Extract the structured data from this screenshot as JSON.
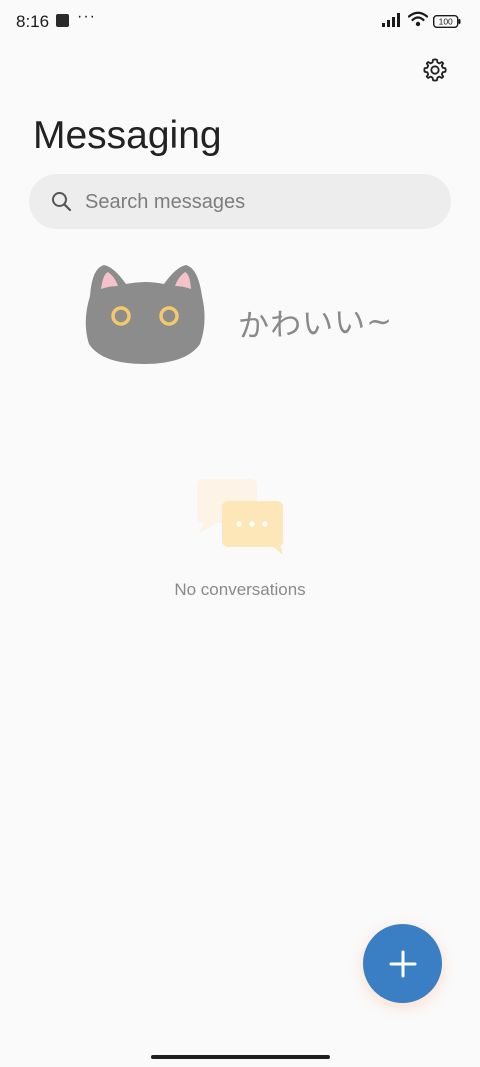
{
  "status_bar": {
    "time": "8:16",
    "dots": "···",
    "battery": "100"
  },
  "header": {
    "title": "Messaging"
  },
  "search": {
    "placeholder": "Search messages"
  },
  "decoration": {
    "cat_caption": "かわいい~"
  },
  "empty_state": {
    "text": "No conversations"
  },
  "colors": {
    "accent": "#3a7fc4",
    "background": "#fafafa",
    "search_bg": "#ededed",
    "empty_icon": "#fde7b8"
  },
  "icons": {
    "settings": "gear-icon",
    "search": "search-icon",
    "fab": "plus-icon",
    "empty": "chat-bubbles-icon"
  }
}
